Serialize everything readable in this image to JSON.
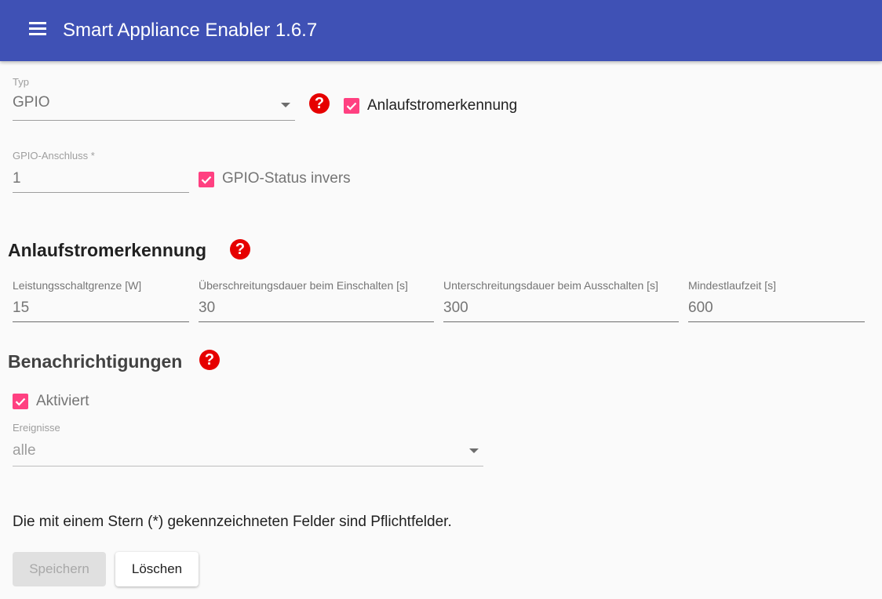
{
  "app": {
    "title": "Smart Appliance Enabler 1.6.7",
    "menu_icon": "menu-icon"
  },
  "type_section": {
    "typ": {
      "label": "Typ",
      "value": "GPIO"
    },
    "startup_current_detection": {
      "label": "Anlaufstromerkennung",
      "checked": true
    },
    "gpio_port": {
      "label": "GPIO-Anschluss *",
      "value": "1"
    },
    "gpio_inverted": {
      "label": "GPIO-Status invers",
      "checked": true
    }
  },
  "startup_section": {
    "title": "Anlaufstromerkennung",
    "fields": [
      {
        "label": "Leistungsschaltgrenze [W]",
        "value": "15"
      },
      {
        "label": "Überschreitungsdauer beim Einschalten [s]",
        "value": "30"
      },
      {
        "label": "Unterschreitungsdauer beim Ausschalten [s]",
        "value": "300"
      },
      {
        "label": "Mindestlaufzeit [s]",
        "value": "600"
      }
    ]
  },
  "notifications_section": {
    "title": "Benachrichtigungen",
    "activated": {
      "label": "Aktiviert",
      "checked": true
    },
    "events": {
      "label": "Ereignisse",
      "value": "alle"
    }
  },
  "footer": {
    "note": "Die mit einem Stern (*) gekennzeichneten Felder sind Pflichtfelder.",
    "save_label": "Speichern",
    "delete_label": "Löschen"
  },
  "colors": {
    "toolbar": "#3f51b5",
    "accent_checkbox": "#ff4081",
    "help_icon": "#e60000"
  }
}
